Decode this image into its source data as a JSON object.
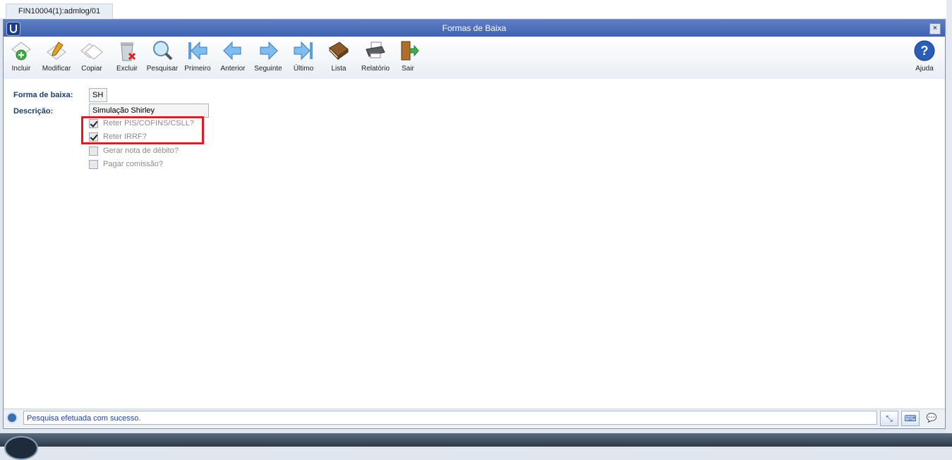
{
  "tab": {
    "label": "FIN10004(1):admlog/01"
  },
  "window": {
    "title": "Formas de Baixa",
    "close_label": "×"
  },
  "toolbar": {
    "buttons": [
      {
        "label": "Incluir",
        "icon": "add-document-icon"
      },
      {
        "label": "Modificar",
        "icon": "edit-document-icon"
      },
      {
        "label": "Copiar",
        "icon": "copy-document-icon"
      },
      {
        "label": "Excluir",
        "icon": "trash-icon"
      },
      {
        "label": "Pesquisar",
        "icon": "magnifier-icon"
      },
      {
        "label": "Primeiro",
        "icon": "first-arrow-icon"
      },
      {
        "label": "Anterior",
        "icon": "previous-arrow-icon"
      },
      {
        "label": "Seguinte",
        "icon": "next-arrow-icon"
      },
      {
        "label": "Último",
        "icon": "last-arrow-icon"
      },
      {
        "label": "Lista",
        "icon": "book-icon"
      },
      {
        "label": "Relatório",
        "icon": "printer-icon"
      },
      {
        "label": "Sair",
        "icon": "exit-door-icon"
      }
    ],
    "help": {
      "label": "Ajuda",
      "icon": "help-icon"
    }
  },
  "form": {
    "forma_label": "Forma de baixa:",
    "forma_value": "SH",
    "descricao_label": "Descrição:",
    "descricao_value": "Simulação Shirley",
    "checkboxes": [
      {
        "label": "Reter PIS/COFINS/CSLL?",
        "checked": true
      },
      {
        "label": "Reter IRRF?",
        "checked": true
      },
      {
        "label": "Gerar nota de débito?",
        "checked": false
      },
      {
        "label": "Pagar comissão?",
        "checked": false
      }
    ]
  },
  "status": {
    "message": "Pesquisa efetuada com sucesso."
  },
  "colors": {
    "highlight": "#e01b24",
    "title_bar": "#4a6cb8"
  }
}
